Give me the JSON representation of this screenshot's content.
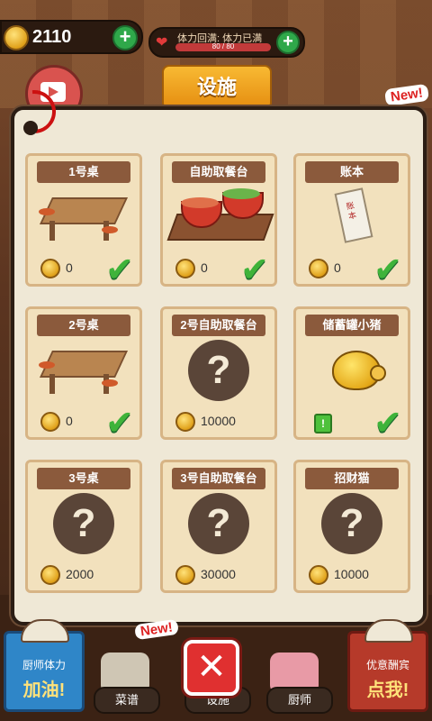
{
  "hud": {
    "coins": "2110",
    "stamina_label": "体力回满: 体力已满",
    "stamina_value": "80 / 80",
    "facility_tab": "设施",
    "new_badge": "New!"
  },
  "cards": [
    {
      "title": "1号桌",
      "cost": "0",
      "owned": true,
      "art": "table"
    },
    {
      "title": "自助取餐台",
      "cost": "0",
      "owned": true,
      "art": "buffet"
    },
    {
      "title": "账本",
      "cost": "0",
      "owned": true,
      "art": "ledger"
    },
    {
      "title": "2号桌",
      "cost": "0",
      "owned": true,
      "art": "table"
    },
    {
      "title": "2号自助取餐台",
      "cost": "10000",
      "owned": false,
      "art": "unknown"
    },
    {
      "title": "储蓄罐小猪",
      "cost": "",
      "owned": true,
      "art": "pig"
    },
    {
      "title": "3号桌",
      "cost": "2000",
      "owned": false,
      "art": "unknown"
    },
    {
      "title": "3号自助取餐台",
      "cost": "30000",
      "owned": false,
      "art": "unknown"
    },
    {
      "title": "招财猫",
      "cost": "10000",
      "owned": false,
      "art": "unknown"
    }
  ],
  "unknown_mark": "?",
  "ledger_text": "账本",
  "bottom": {
    "chef_stamina_l1": "厨师体力",
    "chef_stamina_l2": "加油!",
    "recipes": "菜谱",
    "facilities": "设施",
    "chefs": "厨师",
    "recruit_l1": "优意酬宾",
    "recruit_l2": "点我!",
    "new_badge": "New!",
    "close": "✕"
  }
}
